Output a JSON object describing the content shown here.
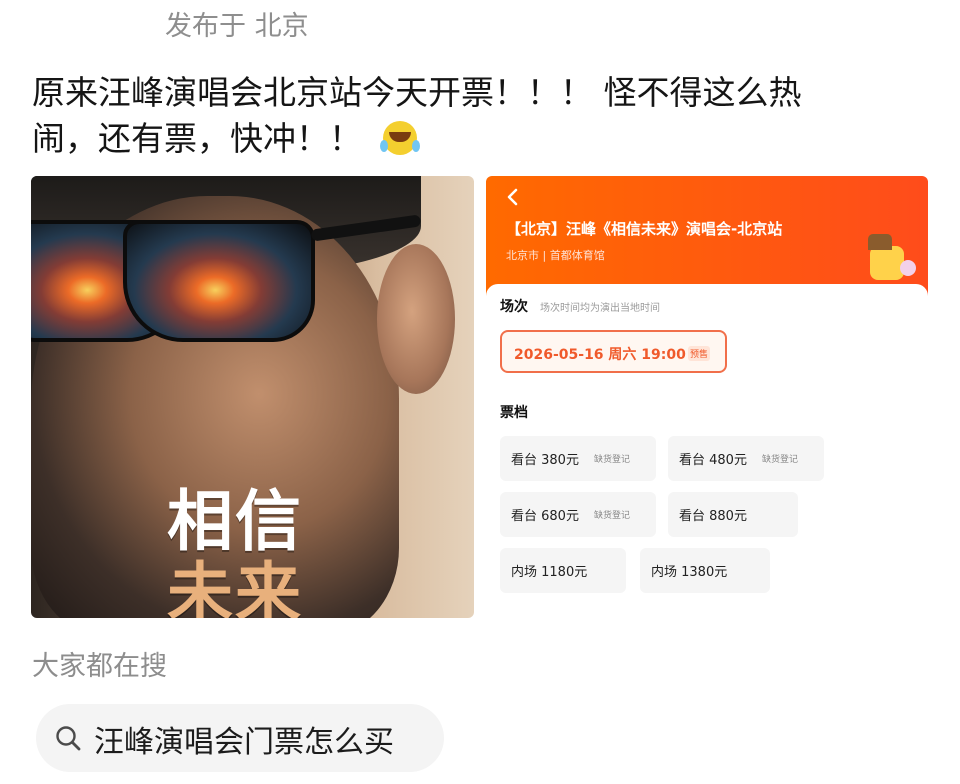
{
  "post": {
    "location": "发布于 北京",
    "text_line1": "原来汪峰演唱会北京站今天开票！！！ 怪不得这么热",
    "text_line2": "闹，还有票，快冲！！",
    "emoji": "laughing-crying-emoji"
  },
  "poster": {
    "title_line1": "相信",
    "title_line2": "未来"
  },
  "ticket_app": {
    "title": "【北京】汪峰《相信未来》演唱会-北京站",
    "venue": "北京市 | 首都体育馆",
    "session_label": "场次",
    "session_note": "场次时间均为演出当地时间",
    "session_value": "2026-05-16 周六 19:00",
    "session_tag": "预售",
    "ticket_label": "票档",
    "tickets": [
      {
        "label": "看台 380元",
        "tag": "缺货登记"
      },
      {
        "label": "看台 480元",
        "tag": "缺货登记"
      },
      {
        "label": "看台 680元",
        "tag": "缺货登记"
      },
      {
        "label": "看台 880元",
        "tag": ""
      },
      {
        "label": "内场 1180元",
        "tag": ""
      },
      {
        "label": "内场 1380元",
        "tag": ""
      }
    ]
  },
  "search": {
    "heading": "大家都在搜",
    "query": "汪峰演唱会门票怎么买"
  }
}
